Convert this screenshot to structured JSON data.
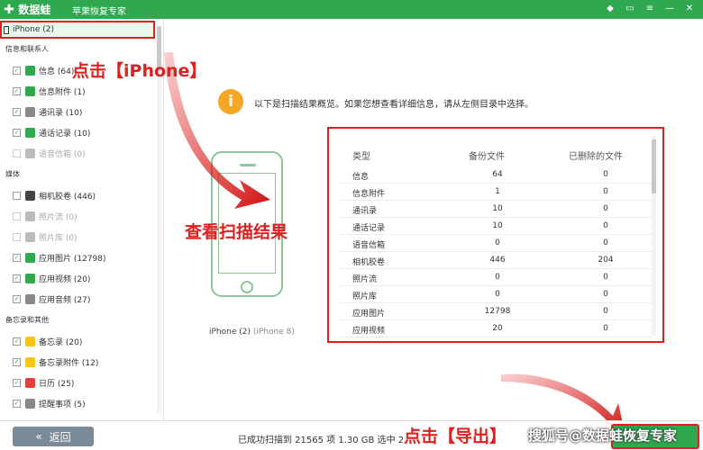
{
  "app": {
    "logo": "数据蛙",
    "name": "苹果恢复专家"
  },
  "device": {
    "item_label": "iPhone (2)",
    "caption_name": "iPhone (2)",
    "caption_model": "(iPhone 8)"
  },
  "sidebar": {
    "groups": [
      {
        "title": "信息和联系人",
        "items": [
          {
            "label": "信息 (64)",
            "icon_color": "#2fa84f",
            "checked": true,
            "disabled": false
          },
          {
            "label": "信息附件 (1)",
            "icon_color": "#2fa84f",
            "checked": true,
            "disabled": false
          },
          {
            "label": "通讯录 (10)",
            "icon_color": "#888888",
            "checked": true,
            "disabled": false
          },
          {
            "label": "通话记录 (10)",
            "icon_color": "#2fa84f",
            "checked": true,
            "disabled": false
          },
          {
            "label": "语音信箱 (0)",
            "icon_color": "#bbbbbb",
            "checked": false,
            "disabled": true
          }
        ]
      },
      {
        "title": "媒体",
        "items": [
          {
            "label": "相机胶卷 (446)",
            "icon_color": "#444444",
            "checked": false,
            "disabled": false
          },
          {
            "label": "照片流 (0)",
            "icon_color": "#bbbbbb",
            "checked": false,
            "disabled": true
          },
          {
            "label": "照片库 (0)",
            "icon_color": "#bbbbbb",
            "checked": false,
            "disabled": true
          },
          {
            "label": "应用图片 (12798)",
            "icon_color": "#2fa84f",
            "checked": true,
            "disabled": false
          },
          {
            "label": "应用视频 (20)",
            "icon_color": "#2fa84f",
            "checked": true,
            "disabled": false
          },
          {
            "label": "应用音频 (27)",
            "icon_color": "#888888",
            "checked": true,
            "disabled": false
          }
        ]
      },
      {
        "title": "备忘录和其他",
        "items": [
          {
            "label": "备忘录 (20)",
            "icon_color": "#f5c518",
            "checked": true,
            "disabled": false
          },
          {
            "label": "备忘录附件 (12)",
            "icon_color": "#f5c518",
            "checked": true,
            "disabled": false
          },
          {
            "label": "日历 (25)",
            "icon_color": "#e04040",
            "checked": true,
            "disabled": false
          },
          {
            "label": "提醒事项 (5)",
            "icon_color": "#888888",
            "checked": true,
            "disabled": false
          }
        ]
      }
    ]
  },
  "main": {
    "info_text": "以下是扫描结果概览。如果您想查看详细信息，请从左侧目录中选择。",
    "table": {
      "headers": [
        "类型",
        "备份文件",
        "已删除的文件"
      ],
      "rows": [
        [
          "信息",
          "64",
          "0"
        ],
        [
          "信息附件",
          "1",
          "0"
        ],
        [
          "通讯录",
          "10",
          "0"
        ],
        [
          "通话记录",
          "10",
          "0"
        ],
        [
          "语音信箱",
          "0",
          "0"
        ],
        [
          "相机胶卷",
          "446",
          "204"
        ],
        [
          "照片流",
          "0",
          "0"
        ],
        [
          "照片库",
          "0",
          "0"
        ],
        [
          "应用图片",
          "12798",
          "0"
        ],
        [
          "应用视频",
          "20",
          "0"
        ]
      ]
    }
  },
  "footer": {
    "back_label": "返回",
    "status": "已成功扫描到 21565 项 1.30 GB  选中 2"
  },
  "annotations": {
    "click_iphone": "点击【iPhone】",
    "view_results": "查看扫描结果",
    "click_export": "点击【导出】"
  },
  "watermark": "搜狐号@数据蛙恢复专家"
}
